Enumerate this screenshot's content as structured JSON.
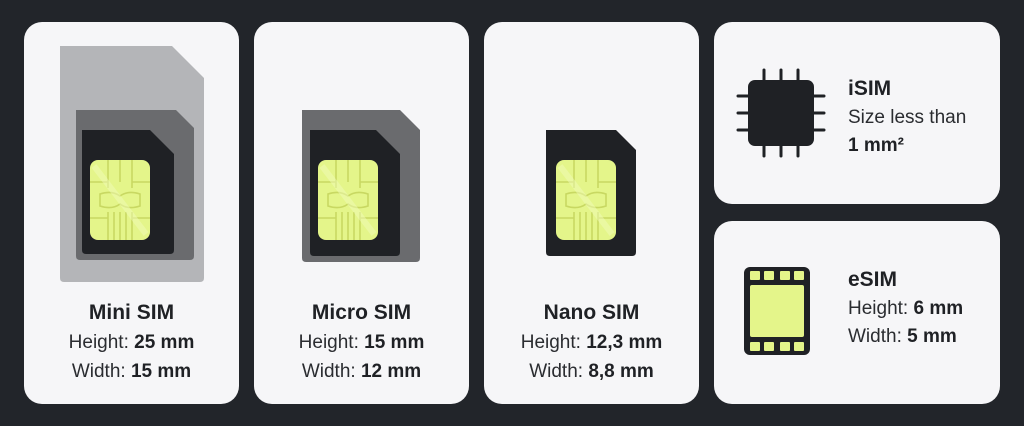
{
  "cards": [
    {
      "name": "Mini SIM",
      "height_label": "Height:",
      "height_value": "25 mm",
      "width_label": "Width:",
      "width_value": "15 mm"
    },
    {
      "name": "Micro SIM",
      "height_label": "Height:",
      "height_value": "15 mm",
      "width_label": "Width:",
      "width_value": "12 mm"
    },
    {
      "name": "Nano SIM",
      "height_label": "Height:",
      "height_value": "12,3 mm",
      "width_label": "Width:",
      "width_value": "8,8 mm"
    }
  ],
  "isim": {
    "name": "iSIM",
    "line1": "Size less than",
    "line2": "1 mm²"
  },
  "esim": {
    "name": "eSIM",
    "height_label": "Height:",
    "height_value": "6 mm",
    "width_label": "Width:",
    "width_value": "5 mm"
  },
  "colors": {
    "background": "#22252a",
    "card": "#f6f6f8",
    "chip": "#e4f58a",
    "sim_dark": "#1f2125",
    "sim_mid": "#6a6b6e",
    "sim_light": "#b4b5b8"
  },
  "icons": [
    "mini-sim-icon",
    "micro-sim-icon",
    "nano-sim-icon",
    "isim-chip-icon",
    "esim-chip-icon"
  ]
}
